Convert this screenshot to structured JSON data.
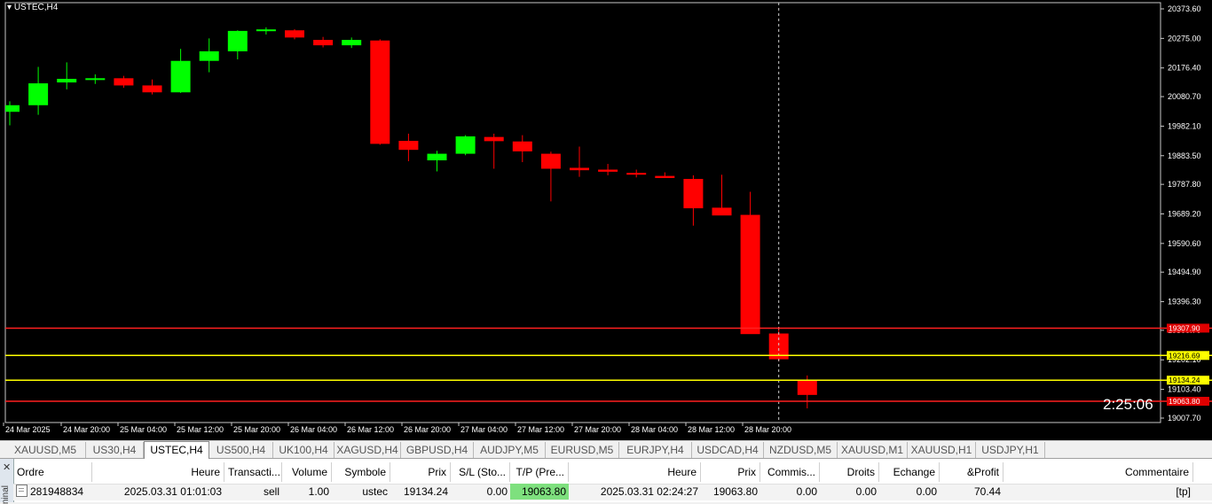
{
  "chart": {
    "symbol_title": "USTEC,H4",
    "countdown": "2:25:06",
    "colors": {
      "bull": "#00ff00",
      "bear": "#ff0000",
      "bg": "#000000",
      "sl_line": "#ff2020",
      "level_line": "#ffff00"
    },
    "price_scale": [
      "20373.60",
      "20275.00",
      "20176.40",
      "20080.70",
      "19982.10",
      "19883.50",
      "19787.80",
      "19689.20",
      "19590.60",
      "19494.90",
      "19396.30",
      "19300.70",
      "19202.10",
      "19103.40",
      "19007.70"
    ],
    "price_tags": [
      {
        "label": "19307.90",
        "kind": "red"
      },
      {
        "label": "19216.69",
        "kind": "yellow"
      },
      {
        "label": "19134.24",
        "kind": "yellow"
      },
      {
        "label": "19063.80",
        "kind": "red"
      }
    ],
    "time_labels": [
      "24 Mar 2025",
      "24 Mar 20:00",
      "25 Mar 04:00",
      "25 Mar 12:00",
      "25 Mar 20:00",
      "26 Mar 04:00",
      "26 Mar 12:00",
      "26 Mar 20:00",
      "27 Mar 04:00",
      "27 Mar 12:00",
      "27 Mar 20:00",
      "28 Mar 04:00",
      "28 Mar 12:00",
      "28 Mar 20:00"
    ]
  },
  "chart_data": {
    "type": "candlestick",
    "title": "USTEC,H4",
    "ylim": [
      18990,
      20400
    ],
    "candles": [
      {
        "o": 20030,
        "h": 20065,
        "l": 19985,
        "c": 20052
      },
      {
        "o": 20052,
        "h": 20180,
        "l": 20020,
        "c": 20125
      },
      {
        "o": 20128,
        "h": 20195,
        "l": 20105,
        "c": 20140
      },
      {
        "o": 20140,
        "h": 20155,
        "l": 20123,
        "c": 20142
      },
      {
        "o": 20142,
        "h": 20150,
        "l": 20110,
        "c": 20118
      },
      {
        "o": 20118,
        "h": 20138,
        "l": 20088,
        "c": 20095
      },
      {
        "o": 20095,
        "h": 20240,
        "l": 20093,
        "c": 20200
      },
      {
        "o": 20200,
        "h": 20275,
        "l": 20162,
        "c": 20232
      },
      {
        "o": 20232,
        "h": 20302,
        "l": 20205,
        "c": 20300
      },
      {
        "o": 20300,
        "h": 20312,
        "l": 20288,
        "c": 20305
      },
      {
        "o": 20302,
        "h": 20306,
        "l": 20272,
        "c": 20278
      },
      {
        "o": 20270,
        "h": 20280,
        "l": 20245,
        "c": 20252
      },
      {
        "o": 20252,
        "h": 20278,
        "l": 20243,
        "c": 20270
      },
      {
        "o": 20268,
        "h": 20272,
        "l": 19920,
        "c": 19923
      },
      {
        "o": 19933,
        "h": 19957,
        "l": 19865,
        "c": 19903
      },
      {
        "o": 19868,
        "h": 19900,
        "l": 19831,
        "c": 19890
      },
      {
        "o": 19890,
        "h": 19952,
        "l": 19885,
        "c": 19948
      },
      {
        "o": 19946,
        "h": 19957,
        "l": 19840,
        "c": 19932
      },
      {
        "o": 19931,
        "h": 19952,
        "l": 19862,
        "c": 19898
      },
      {
        "o": 19890,
        "h": 19897,
        "l": 19731,
        "c": 19840
      },
      {
        "o": 19843,
        "h": 19914,
        "l": 19813,
        "c": 19835
      },
      {
        "o": 19837,
        "h": 19856,
        "l": 19818,
        "c": 19830
      },
      {
        "o": 19826,
        "h": 19837,
        "l": 19811,
        "c": 19822
      },
      {
        "o": 19816,
        "h": 19828,
        "l": 19810,
        "c": 19809
      },
      {
        "o": 19806,
        "h": 19818,
        "l": 19650,
        "c": 19708
      },
      {
        "o": 19710,
        "h": 19820,
        "l": 19692,
        "c": 19684
      },
      {
        "o": 19686,
        "h": 19763,
        "l": 19390,
        "c": 19288
      },
      {
        "o": 19290,
        "h": 19312,
        "l": 19198,
        "c": 19204
      },
      {
        "o": 19132,
        "h": 19150,
        "l": 19040,
        "c": 19085
      }
    ],
    "horizontal_lines": [
      {
        "price": 19307.9,
        "color": "red"
      },
      {
        "price": 19216.69,
        "color": "yellow"
      },
      {
        "price": 19134.24,
        "color": "yellow"
      },
      {
        "price": 19063.8,
        "color": "red"
      }
    ]
  },
  "tabs": [
    "XAUUSD,M5",
    "US30,H4",
    "USTEC,H4",
    "US500,H4",
    "UK100,H4",
    "XAGUSD,H4",
    "GBPUSD,H4",
    "AUDJPY,M5",
    "EURUSD,M5",
    "EURJPY,H4",
    "USDCAD,H4",
    "NZDUSD,M5",
    "XAUUSD,M1",
    "XAUUSD,H1",
    "USDJPY,H1"
  ],
  "active_tab": "USTEC,H4",
  "terminal": {
    "side_label": "ninal",
    "columns": [
      "Ordre",
      "Heure",
      "Transacti...",
      "Volume",
      "Symbole",
      "Prix",
      "S/L (Sto...",
      "T/P (Pre...",
      "Heure",
      "Prix",
      "Commis...",
      "Droits",
      "Echange",
      "&Profit",
      "Commentaire"
    ],
    "rows": [
      [
        "281948834",
        "2025.03.31 01:01:03",
        "sell",
        "1.00",
        "ustec",
        "19134.24",
        "0.00",
        "19063.80",
        "2025.03.31 02:24:27",
        "19063.80",
        "0.00",
        "0.00",
        "0.00",
        "70.44",
        "[tp]"
      ]
    ]
  }
}
